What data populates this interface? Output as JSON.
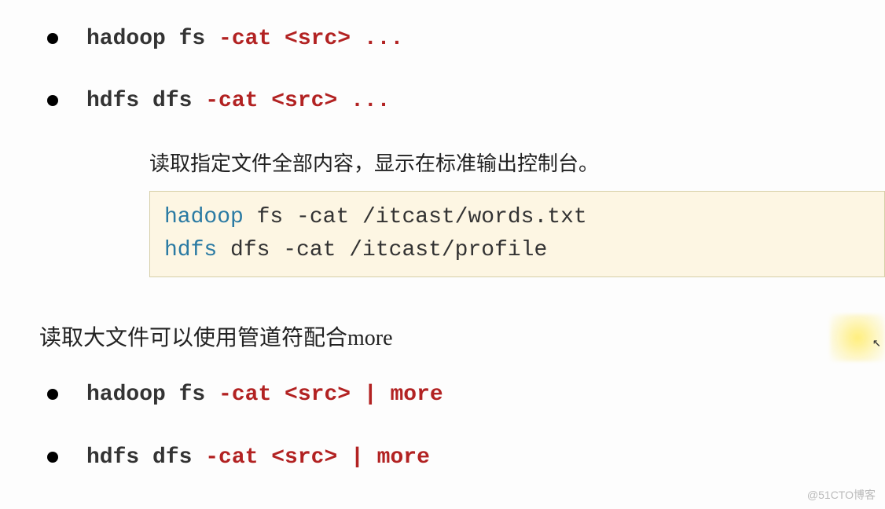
{
  "commands1": [
    {
      "base": "hadoop fs ",
      "option": "-cat <src> ..."
    },
    {
      "base": "hdfs dfs ",
      "option": "-cat <src> ..."
    }
  ],
  "desc1": "读取指定文件全部内容，显示在标准输出控制台。",
  "code_block": {
    "line1_kw": "hadoop",
    "line1_rest": " fs -cat /itcast/words.txt",
    "line2_kw": "hdfs",
    "line2_rest": " dfs -cat /itcast/profile"
  },
  "section2": "读取大文件可以使用管道符配合more",
  "commands2": [
    {
      "base": "hadoop fs ",
      "option": "-cat <src> | more"
    },
    {
      "base": "hdfs dfs ",
      "option": "-cat <src> | more"
    }
  ],
  "watermark": "@51CTO博客"
}
